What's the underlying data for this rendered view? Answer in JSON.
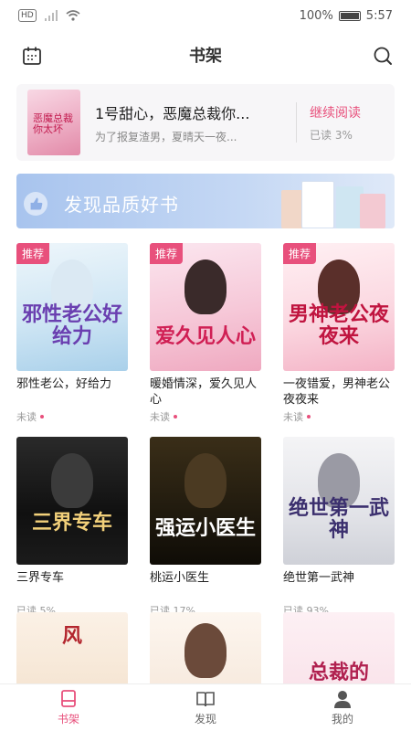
{
  "status_bar": {
    "network": "HD",
    "battery": "100%",
    "time": "5:57"
  },
  "header": {
    "title": "书架"
  },
  "reading": {
    "cover_title": "恶魔总裁你太坏",
    "title": "1号甜心，恶魔总裁你...",
    "desc": "为了报复渣男，夏晴天一夜...",
    "continue_label": "继续阅读",
    "progress": "已读 3%"
  },
  "banner": {
    "text": "发现品质好书"
  },
  "books": [
    {
      "tag": "推荐",
      "cover_title": "邪性老公好给力",
      "title": "邪性老公，好给力",
      "status": "未读",
      "unread": true
    },
    {
      "tag": "推荐",
      "cover_title": "爱久见人心",
      "title": "暖婚情深，爱久见人心",
      "status": "未读",
      "unread": true
    },
    {
      "tag": "推荐",
      "cover_title": "男神老公夜夜来",
      "title": "一夜错爱，男神老公夜夜来",
      "status": "未读",
      "unread": true
    },
    {
      "tag": "",
      "cover_title": "三界专车",
      "title": "三界专车",
      "status": "已读 5%",
      "unread": false
    },
    {
      "tag": "",
      "cover_title": "强运小医生",
      "title": "桃运小医生",
      "status": "已读 17%",
      "unread": false
    },
    {
      "tag": "",
      "cover_title": "绝世第一武神",
      "title": "绝世第一武神",
      "status": "已读 93%",
      "unread": false
    },
    {
      "tag": "",
      "cover_title": "风",
      "title": "",
      "status": "",
      "unread": false
    },
    {
      "tag": "",
      "cover_title": "",
      "title": "",
      "status": "",
      "unread": false
    },
    {
      "tag": "",
      "cover_title": "总裁的",
      "title": "",
      "status": "",
      "unread": false
    }
  ],
  "tabs": [
    {
      "label": "书架",
      "icon": "bookshelf-icon",
      "active": true
    },
    {
      "label": "发现",
      "icon": "open-book-icon",
      "active": false
    },
    {
      "label": "我的",
      "icon": "user-icon",
      "active": false
    }
  ],
  "colors": {
    "accent": "#e8507c",
    "card_bg": "#f7f6f8",
    "banner": "#b7cef2"
  }
}
